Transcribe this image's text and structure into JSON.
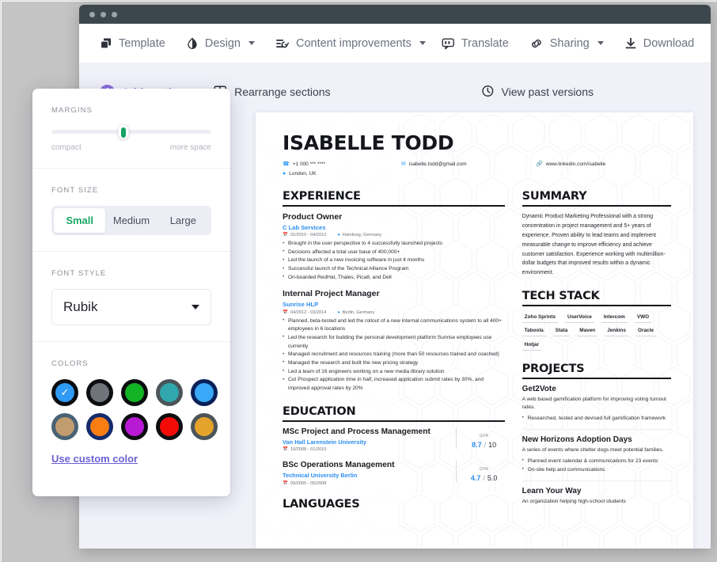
{
  "window": {
    "traffic_dots": 3
  },
  "toolbar": {
    "items": [
      {
        "label": "Template",
        "icon": "copy-icon",
        "caret": false
      },
      {
        "label": "Design",
        "icon": "contrast-icon",
        "caret": true
      },
      {
        "label": "Content improvements",
        "icon": "checklist-icon",
        "caret": true
      }
    ],
    "right_items": [
      {
        "label": "Translate",
        "icon": "translate-icon",
        "caret": false
      },
      {
        "label": "Sharing",
        "icon": "link-icon",
        "caret": true
      },
      {
        "label": "Download",
        "icon": "download-icon",
        "caret": false
      }
    ]
  },
  "actionbar": {
    "add_section": "Add section",
    "rearrange": "Rearrange sections",
    "past_versions": "View past versions"
  },
  "panel": {
    "margins": {
      "label": "MARGINS",
      "left_end": "compact",
      "right_end": "more space",
      "value_percent": 45,
      "thumb_color": "#17a262"
    },
    "font_size": {
      "label": "FONT SIZE",
      "options": [
        "Small",
        "Medium",
        "Large"
      ],
      "selected": "Small",
      "active_color": "#18a565"
    },
    "font_style": {
      "label": "FONT STYLE",
      "selected": "Rubik"
    },
    "colors": {
      "label": "COLORS",
      "custom_link": "Use custom color",
      "selected_index": 0,
      "swatches": [
        {
          "ring": "#0b0d10",
          "fill": "#2f9bf5",
          "selected": true
        },
        {
          "ring": "#0c0e11",
          "fill": "#6f747b",
          "selected": false
        },
        {
          "ring": "#0b0d10",
          "fill": "#12b325",
          "selected": false
        },
        {
          "ring": "#4b5559",
          "fill": "#2fa7ac",
          "selected": false
        },
        {
          "ring": "#0a2059",
          "fill": "#38a8f7",
          "selected": false
        },
        {
          "ring": "#4a6275",
          "fill": "#c19c6e",
          "selected": false
        },
        {
          "ring": "#152a6b",
          "fill": "#f87e13",
          "selected": false
        },
        {
          "ring": "#0b0d10",
          "fill": "#b81ad4",
          "selected": false
        },
        {
          "ring": "#0b0d10",
          "fill": "#f40b08",
          "selected": false
        },
        {
          "ring": "#4b5559",
          "fill": "#e4a32a",
          "selected": false
        }
      ]
    }
  },
  "resume": {
    "name": "ISABELLE TODD",
    "contacts": {
      "phone": "+1 000 *** ****",
      "location": "London, UK",
      "email": "isabelle.todd@gmail.com",
      "linkedin": "www.linkedin.com/isabelle"
    },
    "experience": {
      "heading": "EXPERIENCE",
      "jobs": [
        {
          "title": "Product Owner",
          "company": "C Lab Services",
          "dates": "02/2010 - 04/2012",
          "location": "Hamburg, Germany",
          "bullets": [
            "Brought in the user perspective to 4 successfully launched projects",
            "Decisions affected a total user base of 400,000+",
            "Led the launch of a new invoicing software in just 4 months",
            "Successful launch of the Technical Alliance Program",
            "On-boarded RedHat, Thales, Pica8, and Dell"
          ]
        },
        {
          "title": "Internal Project Manager",
          "company": "Sunrise HLP",
          "dates": "04/2012 - 03/2014",
          "location": "Berlin, Germany",
          "bullets": [
            "Planned, beta-tested and led the rollout of a new internal communications system to all 400+ employees in 6 locations",
            "Led the research for building the personal development platform Sunrise employees use currently",
            "Managed recruitment and resources training (more than 50 resources trained and coached)",
            "Managed the research and built the new pricing strategy",
            "Led a team of 16 engineers working on a new media library solution",
            "Cut Prospect application time in half, increased application submit rates by 30%, and improved approval rates by 20%"
          ]
        }
      ]
    },
    "education": {
      "heading": "EDUCATION",
      "entries": [
        {
          "degree": "MSc Project and Process Management",
          "university": "Van Hall Larenstein University",
          "dates": "10/2008 - 01/2010",
          "gpa_label": "GPA",
          "gpa_value": "8.7",
          "gpa_max": "10"
        },
        {
          "degree": "BSc Operations Management",
          "university": "Technical University Berlin",
          "dates": "09/2005 - 05/2008",
          "gpa_label": "GPA",
          "gpa_value": "4.7",
          "gpa_max": "5.0"
        }
      ]
    },
    "languages": {
      "heading": "LANGUAGES"
    },
    "summary": {
      "heading": "SUMMARY",
      "text": "Dynamic Product Marketing Professional with a strong concentration in project management and 5+ years of experience. Proven ability to lead teams and implement measurable change to improve efficiency and achieve customer satisfaction. Experience working with multimillion-dollar budgets that improved results within a dynamic environment."
    },
    "tech_stack": {
      "heading": "TECH STACK",
      "items": [
        "Zoho Sprints",
        "UserVoice",
        "Intercom",
        "VWO",
        "Taboola",
        "Stata",
        "Maven",
        "Jenkins",
        "Oracle",
        "Hotjar"
      ]
    },
    "projects": {
      "heading": "PROJECTS",
      "items": [
        {
          "title": "Get2Vote",
          "description": "A web based gamification platform for improving voting turnout rates.",
          "bullets": [
            "Researched, tested and devised full gamification framework"
          ]
        },
        {
          "title": "New Horizons Adoption Days",
          "description": "A series of events where shelter dogs meet potential families.",
          "bullets": [
            "Planned event calendar & communications for 23 events",
            "On-site help and communications"
          ]
        },
        {
          "title": "Learn Your Way",
          "description": "An organization helping high-school students",
          "bullets": []
        }
      ]
    }
  }
}
